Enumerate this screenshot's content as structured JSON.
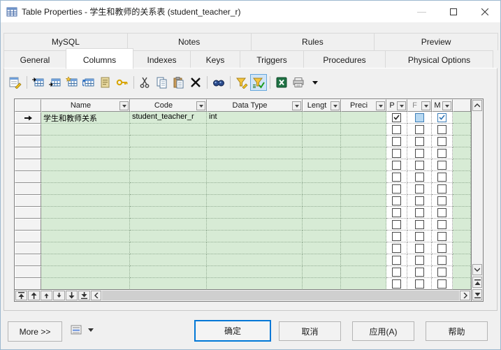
{
  "window": {
    "title": "Table Properties - 学生和教师的关系表 (student_teacher_r)",
    "controls": [
      {
        "name": "minimize",
        "glyph": "–"
      },
      {
        "name": "maximize",
        "glyph": "□"
      },
      {
        "name": "close",
        "glyph": "✕"
      }
    ]
  },
  "tabs": {
    "active": "Columns",
    "row1": [
      "MySQL",
      "Notes",
      "Rules",
      "Preview"
    ],
    "row2": [
      "General",
      "Columns",
      "Indexes",
      "Keys",
      "Triggers",
      "Procedures",
      "Physical Options"
    ],
    "row2_widths": [
      90,
      97,
      83,
      72,
      92,
      118,
      155
    ]
  },
  "toolbar": {
    "items": [
      "properties",
      "|",
      "insert-row",
      "add-row",
      "new-row",
      "replicate-row",
      "note",
      "key",
      "|",
      "cut",
      "copy",
      "paste",
      "delete",
      "|",
      "find",
      "|",
      "filter-edit",
      "filter-active",
      "|",
      "excel-export",
      "print",
      "caret-down"
    ],
    "active_item": "filter-active"
  },
  "grid": {
    "headers": [
      {
        "label": "",
        "dropdown": false
      },
      {
        "label": "Name",
        "dropdown": true
      },
      {
        "label": "Code",
        "dropdown": true
      },
      {
        "label": "Data Type",
        "dropdown": true
      },
      {
        "label": "Lengt",
        "dropdown": true
      },
      {
        "label": "Preci",
        "dropdown": true
      },
      {
        "label": "P",
        "dropdown": true
      },
      {
        "label": "F",
        "dropdown": true,
        "dim": true
      },
      {
        "label": "M",
        "dropdown": true
      },
      {
        "label": "",
        "dropdown": false
      }
    ],
    "rows": [
      {
        "name": "学生和教师关系",
        "code": "student_teacher_r",
        "data_type": "int",
        "length": "",
        "precision": "",
        "p": "checked",
        "f": "filled",
        "m": "checked-blue"
      }
    ],
    "empty_rows": 14,
    "row_move_buttons": [
      "move-first",
      "move-up-many",
      "move-up",
      "move-down",
      "move-down-many",
      "move-last"
    ]
  },
  "footer": {
    "more": "More >>",
    "ok": "确定",
    "cancel": "取消",
    "apply": "应用(A)",
    "help": "帮助"
  },
  "colors": {
    "grid_green": "#d7ebd5",
    "accent_blue": "#0078d7",
    "checkbox_blue": "#3e7fb8",
    "filter_active_bg": "#cfe4f7"
  }
}
